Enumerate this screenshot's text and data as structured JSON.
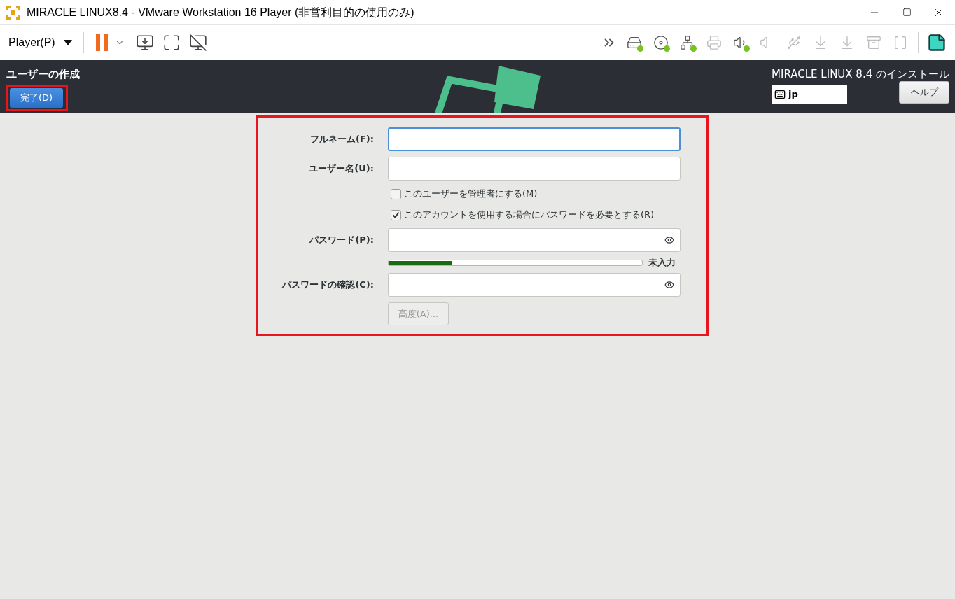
{
  "window": {
    "title": "MIRACLE LINUX8.4 - VMware Workstation 16 Player (非営利目的の使用のみ)"
  },
  "toolbar": {
    "player_menu": "Player(P)",
    "devices": [
      {
        "connected": true,
        "disabled": false
      },
      {
        "connected": true,
        "disabled": false
      },
      {
        "connected": true,
        "disabled": false
      },
      {
        "connected": false,
        "disabled": true
      },
      {
        "connected": true,
        "disabled": false
      },
      {
        "connected": false,
        "disabled": true
      },
      {
        "connected": false,
        "disabled": true
      },
      {
        "connected": false,
        "disabled": true
      },
      {
        "connected": false,
        "disabled": true
      },
      {
        "connected": false,
        "disabled": true
      },
      {
        "connected": false,
        "disabled": true
      }
    ]
  },
  "header": {
    "title": "ユーザーの作成",
    "done_button": "完了(D)",
    "product": "MIRACLE LINUX 8.4 のインストール",
    "keyboard": "jp",
    "help_button": "ヘルプ"
  },
  "form": {
    "fields": [
      {
        "kind": "text",
        "label": "フルネーム(F):",
        "focused": true
      },
      {
        "kind": "text",
        "label": "ユーザー名(U):",
        "focused": false
      },
      {
        "kind": "checkbox",
        "label": "このユーザーを管理者にする(M)",
        "checked": false
      },
      {
        "kind": "checkbox",
        "label": "このアカウントを使用する場合にパスワードを必要とする(R)",
        "checked": true
      },
      {
        "kind": "password",
        "label": "パスワード(P):",
        "focused": false
      },
      {
        "kind": "strength",
        "level": 0.25,
        "reading": "未入力"
      },
      {
        "kind": "password",
        "label": "パスワードの確認(C):",
        "focused": false
      }
    ],
    "advanced_button": {
      "label": "高度(A)...",
      "disabled": true
    }
  }
}
